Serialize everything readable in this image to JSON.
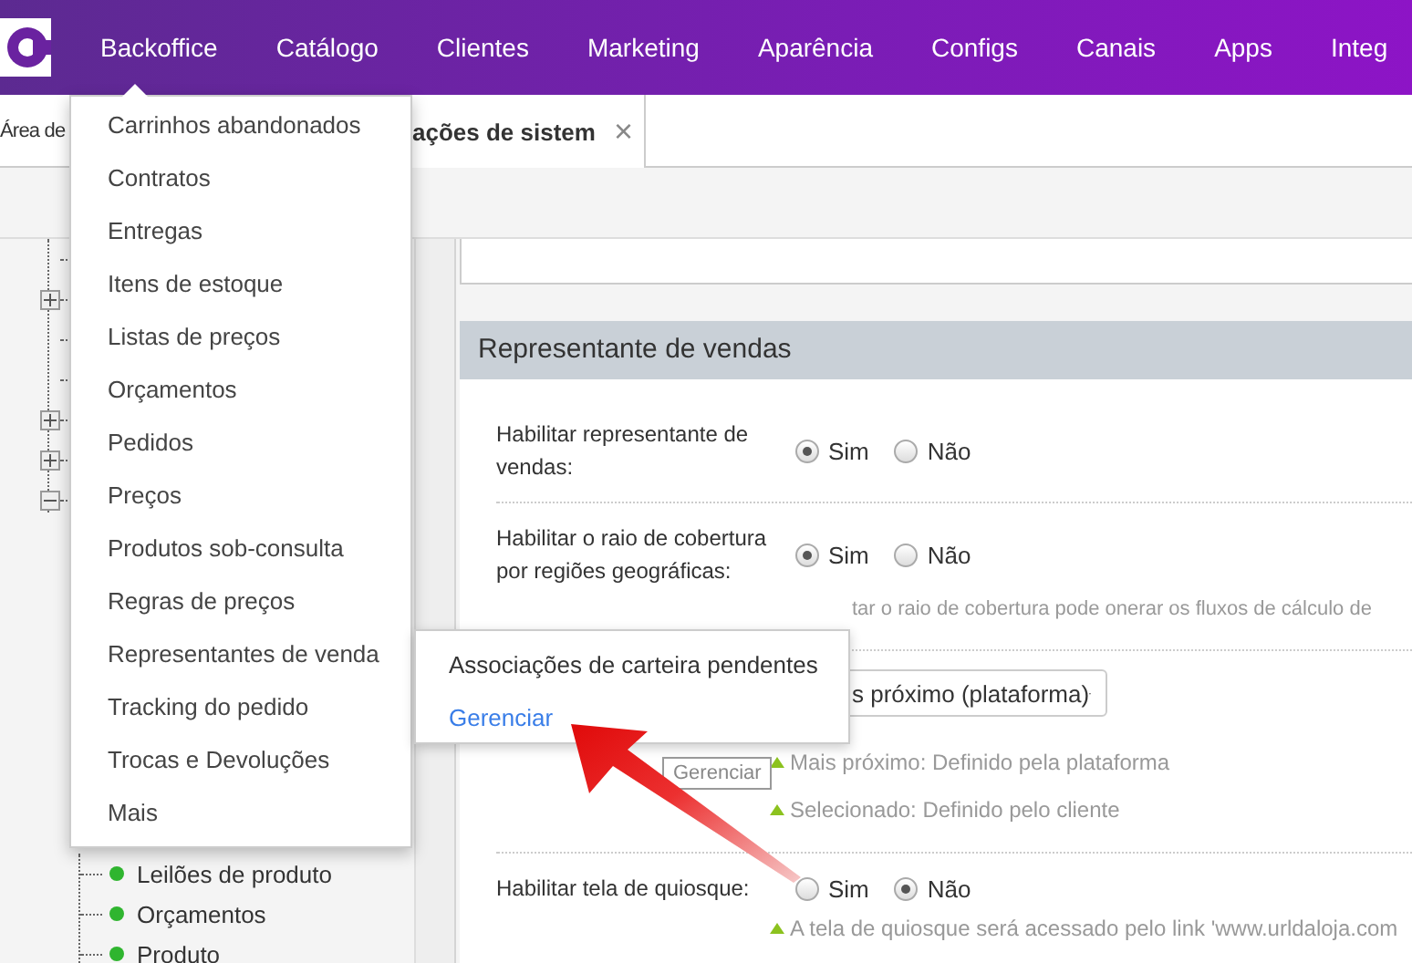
{
  "topbar": {
    "nav": [
      {
        "label": "Backoffice"
      },
      {
        "label": "Catálogo"
      },
      {
        "label": "Clientes"
      },
      {
        "label": "Marketing"
      },
      {
        "label": "Aparência"
      },
      {
        "label": "Configs"
      },
      {
        "label": "Canais"
      },
      {
        "label": "Apps"
      },
      {
        "label": "Integ"
      }
    ]
  },
  "tabs": [
    {
      "label": "Área de",
      "selected": false
    },
    {
      "label": "ações de sistem",
      "selected": true,
      "close": "×"
    }
  ],
  "tree": [
    {
      "kind": "leaf"
    },
    {
      "kind": "folder",
      "expanded": false
    },
    {
      "kind": "leaf"
    },
    {
      "kind": "leaf"
    },
    {
      "kind": "folder",
      "expanded": false
    },
    {
      "kind": "folder",
      "expanded": false
    },
    {
      "kind": "folder",
      "expanded": true,
      "children": [
        {
          "label": "Leilões de produto",
          "color": "#2fb52f"
        },
        {
          "label": "Orçamentos",
          "color": "#2fb52f"
        },
        {
          "label": "Produto",
          "color": "#2fb52f"
        }
      ]
    }
  ],
  "section": {
    "title": "Representante de vendas",
    "rows": [
      {
        "kind": "radio",
        "label": "Habilitar representante de vendas:",
        "options": [
          {
            "label": "Sim",
            "selected": true
          },
          {
            "label": "Não",
            "selected": false
          }
        ]
      },
      {
        "kind": "radio",
        "label": "Habilitar o raio de cobertura por regiões geográficas:",
        "options": [
          {
            "label": "Sim",
            "selected": true
          },
          {
            "label": "Não",
            "selected": false
          }
        ],
        "hints": [
          {
            "text": "tar o raio de cobertura pode onerar os fluxos de cálculo de",
            "bullet": false
          }
        ]
      },
      {
        "kind": "select",
        "value": "s próximo (plataforma)",
        "hints": [
          {
            "text": "Mais próximo: Definido pela plataforma",
            "bullet": true
          },
          {
            "text": "Selecionado: Definido pelo cliente",
            "bullet": true
          }
        ]
      },
      {
        "kind": "radio",
        "label": "Habilitar tela de quiosque:",
        "options": [
          {
            "label": "Sim",
            "selected": false
          },
          {
            "label": "Não",
            "selected": true
          }
        ],
        "hints": [
          {
            "text": "A tela de quiosque será acessado pelo link 'www.urldaloja.com",
            "bullet": true
          }
        ]
      }
    ]
  },
  "backoffice_menu": {
    "items": [
      "Carrinhos abandonados",
      "Contratos",
      "Entregas",
      "Itens de estoque",
      "Listas de preços",
      "Orçamentos",
      "Pedidos",
      "Preços",
      "Produtos sob-consulta",
      "Regras de preços",
      "Representantes de venda",
      "Tracking do pedido",
      "Trocas e Devoluções",
      "Mais"
    ]
  },
  "submenu": {
    "items": [
      {
        "kind": "text",
        "label": "Associações de carteira pendentes"
      },
      {
        "kind": "link",
        "label": "Gerenciar"
      }
    ]
  },
  "tooltip": {
    "text": "Gerenciar"
  }
}
